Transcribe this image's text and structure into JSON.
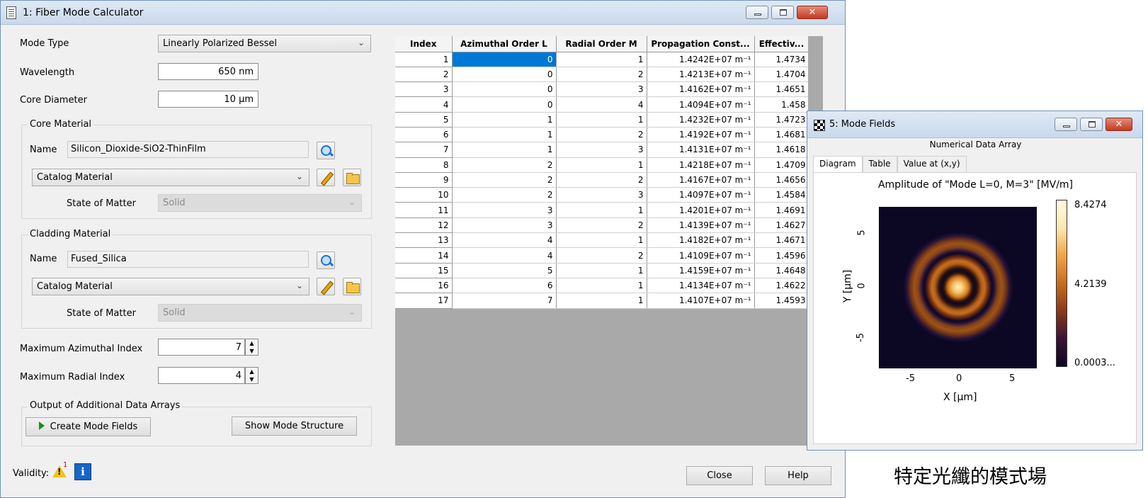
{
  "main_window": {
    "title": "1: Fiber Mode Calculator",
    "mode_type_label": "Mode Type",
    "mode_type_value": "Linearly Polarized Bessel",
    "wavelength_label": "Wavelength",
    "wavelength_value": "650 nm",
    "core_diameter_label": "Core Diameter",
    "core_diameter_value": "10 µm",
    "core_material": {
      "group_title": "Core Material",
      "name_label": "Name",
      "name_value": "Silicon_Dioxide-SiO2-ThinFilm",
      "source_value": "Catalog Material",
      "state_label": "State of Matter",
      "state_value": "Solid"
    },
    "cladding_material": {
      "group_title": "Cladding Material",
      "name_label": "Name",
      "name_value": "Fused_Silica",
      "source_value": "Catalog Material",
      "state_label": "State of Matter",
      "state_value": "Solid"
    },
    "max_azimuthal_label": "Maximum Azimuthal Index",
    "max_azimuthal_value": "7",
    "max_radial_label": "Maximum Radial Index",
    "max_radial_value": "4",
    "output_group_title": "Output of Additional Data Arrays",
    "create_mode_fields_label": "Create Mode Fields",
    "show_mode_structure_label": "Show Mode Structure",
    "validity_label": "Validity:",
    "validity_warning_count": "1",
    "close_label": "Close",
    "help_label": "Help"
  },
  "mode_table": {
    "columns": [
      "Index",
      "Azimuthal Order L",
      "Radial Order M",
      "Propagation Const...",
      "Effectiv..."
    ],
    "rows": [
      [
        "1",
        "0",
        "1",
        "1.4242E+07 m⁻¹",
        "1.4734"
      ],
      [
        "2",
        "0",
        "2",
        "1.4213E+07 m⁻¹",
        "1.4704"
      ],
      [
        "3",
        "0",
        "3",
        "1.4162E+07 m⁻¹",
        "1.4651"
      ],
      [
        "4",
        "0",
        "4",
        "1.4094E+07 m⁻¹",
        "1.458"
      ],
      [
        "5",
        "1",
        "1",
        "1.4232E+07 m⁻¹",
        "1.4723"
      ],
      [
        "6",
        "1",
        "2",
        "1.4192E+07 m⁻¹",
        "1.4681"
      ],
      [
        "7",
        "1",
        "3",
        "1.4131E+07 m⁻¹",
        "1.4618"
      ],
      [
        "8",
        "2",
        "1",
        "1.4218E+07 m⁻¹",
        "1.4709"
      ],
      [
        "9",
        "2",
        "2",
        "1.4167E+07 m⁻¹",
        "1.4656"
      ],
      [
        "10",
        "2",
        "3",
        "1.4097E+07 m⁻¹",
        "1.4584"
      ],
      [
        "11",
        "3",
        "1",
        "1.4201E+07 m⁻¹",
        "1.4691"
      ],
      [
        "12",
        "3",
        "2",
        "1.4139E+07 m⁻¹",
        "1.4627"
      ],
      [
        "13",
        "4",
        "1",
        "1.4182E+07 m⁻¹",
        "1.4671"
      ],
      [
        "14",
        "4",
        "2",
        "1.4109E+07 m⁻¹",
        "1.4596"
      ],
      [
        "15",
        "5",
        "1",
        "1.4159E+07 m⁻¹",
        "1.4648"
      ],
      [
        "16",
        "6",
        "1",
        "1.4134E+07 m⁻¹",
        "1.4622"
      ],
      [
        "17",
        "7",
        "1",
        "1.4107E+07 m⁻¹",
        "1.4593"
      ]
    ]
  },
  "fields_window": {
    "title": "5: Mode Fields",
    "subtitle": "Numerical Data Array",
    "tabs": [
      "Diagram",
      "Table",
      "Value at (x,y)"
    ],
    "plot_title": "Amplitude of \"Mode L=0, M=3\"  [MV/m]",
    "xlabel": "X [µm]",
    "ylabel": "Y [µm]",
    "x_ticks": [
      "-5",
      "0",
      "5"
    ],
    "y_ticks": [
      "5",
      "0",
      "-5"
    ],
    "colorbar_max": "8.4274",
    "colorbar_mid": "4.2139",
    "colorbar_min": "0.0003..."
  },
  "caption": "特定光纖的模式場",
  "colors": {
    "selection": "#0078d7",
    "colormap_low": "#0c0824",
    "colormap_high": "#fffbe2"
  }
}
